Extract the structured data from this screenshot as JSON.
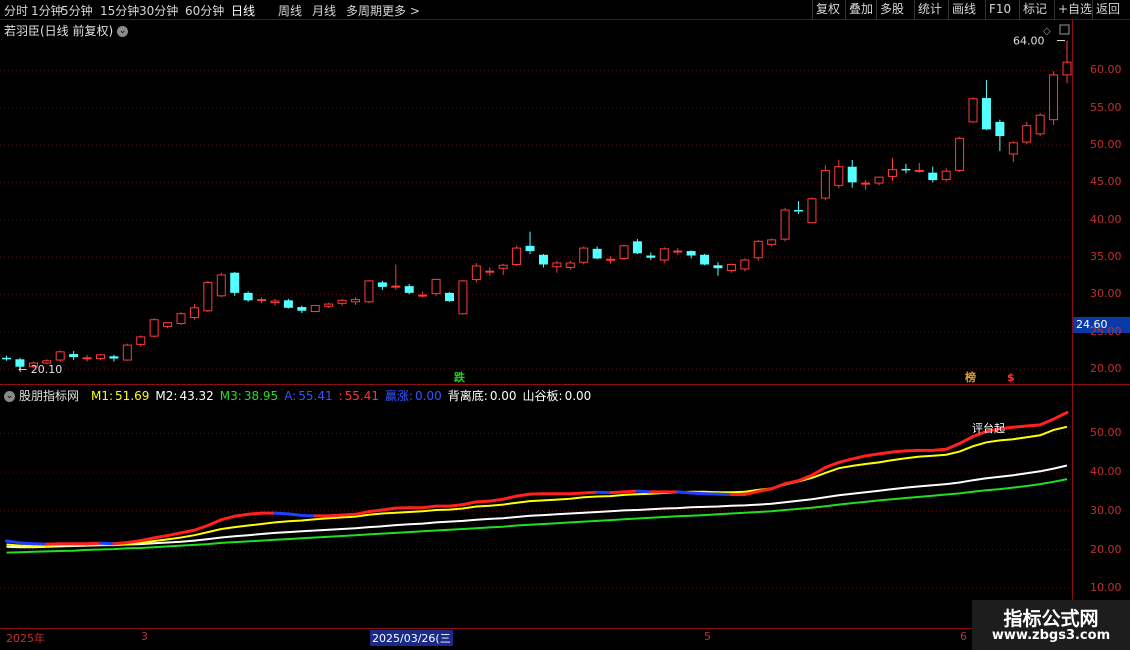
{
  "toolbar": {
    "tabs": [
      "分时",
      "1分钟",
      "5分钟",
      "15分钟",
      "30分钟",
      "60分钟",
      "日线",
      "周线",
      "月线",
      "多周期",
      "更多 >"
    ],
    "active_tab": "日线",
    "right_buttons": [
      "复权",
      "叠加",
      "多股",
      "统计",
      "画线",
      "F10",
      "标记",
      "+自选",
      "返回"
    ]
  },
  "main_chart": {
    "title": "若羽臣(日线 前复权)",
    "max_label": "64.00",
    "min_label": "20.10",
    "current_price": "24.60",
    "y_ticks": [
      "60.00",
      "55.00",
      "50.00",
      "45.00",
      "40.00",
      "35.00",
      "30.00",
      "25.00",
      "20.00"
    ],
    "markers": [
      "跌",
      "榜",
      "$"
    ]
  },
  "indicator": {
    "name": "股朋指标网",
    "items": [
      {
        "label": "M1:",
        "value": "51.69",
        "color": "#ffff00"
      },
      {
        "label": "M2:",
        "value": "43.32",
        "color": "#ffffff"
      },
      {
        "label": "M3:",
        "value": "38.95",
        "color": "#22dd22"
      },
      {
        "label": "A:",
        "value": "55.41",
        "color": "#3355ff"
      },
      {
        "label": ":",
        "value": "55.41",
        "color": "#ff3333"
      },
      {
        "label": "赢涨:",
        "value": "0.00",
        "color": "#3355ff"
      },
      {
        "label": "背离底:",
        "value": "0.00",
        "color": "#ffffff"
      },
      {
        "label": "山谷板:",
        "value": "0.00",
        "color": "#ffffff"
      }
    ],
    "annotation": "评台起",
    "y_ticks": [
      "50.00",
      "40.00",
      "30.00",
      "20.00",
      "10.00"
    ]
  },
  "date_axis": [
    "2025年",
    "3",
    "2025/03/26(三",
    "5",
    "6"
  ],
  "watermark": {
    "line1": "指标公式网",
    "line2": "www.zbgs3.com"
  },
  "colors": {
    "up": "#ff3b3b",
    "down": "#54ffff",
    "grid": "#8a1010",
    "axis_text": "#c03030"
  },
  "chart_data": {
    "type": "candlestick",
    "ylim": [
      18,
      66
    ],
    "candles": [
      [
        21.5,
        21.8,
        21.1,
        21.3
      ],
      [
        21.3,
        21.5,
        20.0,
        20.3
      ],
      [
        20.3,
        21.0,
        20.1,
        20.8
      ],
      [
        20.8,
        21.3,
        20.6,
        21.1
      ],
      [
        21.2,
        22.5,
        21.0,
        22.3
      ],
      [
        22.0,
        22.4,
        21.2,
        21.6
      ],
      [
        21.4,
        21.9,
        21.0,
        21.5
      ],
      [
        21.4,
        22.0,
        21.2,
        21.9
      ],
      [
        21.7,
        21.9,
        21.0,
        21.4
      ],
      [
        21.2,
        23.4,
        21.1,
        23.2
      ],
      [
        23.3,
        24.5,
        23.0,
        24.3
      ],
      [
        24.4,
        26.8,
        24.2,
        26.6
      ],
      [
        25.7,
        26.3,
        25.5,
        26.2
      ],
      [
        26.1,
        27.6,
        25.9,
        27.4
      ],
      [
        26.9,
        28.7,
        26.6,
        28.2
      ],
      [
        27.8,
        31.8,
        27.6,
        31.6
      ],
      [
        29.8,
        32.9,
        29.6,
        32.6
      ],
      [
        32.9,
        33.0,
        29.8,
        30.2
      ],
      [
        30.2,
        30.4,
        29.0,
        29.2
      ],
      [
        29.2,
        29.6,
        28.8,
        29.3
      ],
      [
        28.9,
        29.4,
        28.5,
        29.1
      ],
      [
        29.2,
        29.4,
        28.1,
        28.2
      ],
      [
        28.3,
        28.5,
        27.5,
        27.8
      ],
      [
        27.7,
        28.6,
        27.6,
        28.5
      ],
      [
        28.4,
        28.9,
        28.2,
        28.7
      ],
      [
        28.8,
        29.4,
        28.5,
        29.2
      ],
      [
        29.0,
        29.6,
        28.6,
        29.3
      ],
      [
        29.0,
        31.9,
        28.8,
        31.8
      ],
      [
        31.6,
        31.8,
        30.6,
        31.0
      ],
      [
        31.1,
        34.0,
        30.6,
        31.1
      ],
      [
        31.1,
        31.4,
        30.0,
        30.2
      ],
      [
        29.9,
        30.4,
        29.6,
        29.9
      ],
      [
        30.1,
        32.1,
        29.8,
        32.0
      ],
      [
        30.2,
        30.3,
        29.0,
        29.1
      ],
      [
        27.4,
        31.9,
        27.3,
        31.8
      ],
      [
        32.0,
        34.2,
        31.6,
        33.8
      ],
      [
        33.0,
        33.6,
        32.5,
        33.1
      ],
      [
        33.5,
        34.1,
        32.6,
        33.9
      ],
      [
        34.0,
        36.5,
        33.8,
        36.2
      ],
      [
        36.5,
        38.4,
        35.4,
        35.8
      ],
      [
        35.3,
        35.4,
        33.6,
        34.0
      ],
      [
        33.7,
        34.5,
        32.9,
        34.2
      ],
      [
        33.6,
        34.5,
        33.3,
        34.2
      ],
      [
        34.3,
        36.4,
        34.0,
        36.2
      ],
      [
        36.1,
        36.4,
        34.7,
        34.8
      ],
      [
        34.7,
        35.1,
        34.1,
        34.7
      ],
      [
        34.8,
        36.7,
        34.6,
        36.5
      ],
      [
        37.1,
        37.4,
        35.4,
        35.5
      ],
      [
        35.2,
        35.6,
        34.6,
        34.9
      ],
      [
        34.6,
        36.3,
        34.2,
        36.1
      ],
      [
        35.7,
        36.2,
        35.3,
        35.8
      ],
      [
        35.8,
        35.9,
        34.8,
        35.2
      ],
      [
        35.3,
        35.4,
        33.9,
        34.0
      ],
      [
        33.9,
        34.3,
        32.5,
        33.5
      ],
      [
        33.2,
        34.1,
        32.9,
        34.0
      ],
      [
        33.4,
        34.8,
        33.1,
        34.6
      ],
      [
        34.9,
        37.3,
        34.5,
        37.1
      ],
      [
        36.7,
        37.5,
        36.4,
        37.3
      ],
      [
        37.4,
        41.6,
        37.1,
        41.3
      ],
      [
        41.3,
        42.5,
        40.8,
        41.1
      ],
      [
        39.6,
        43.0,
        39.5,
        42.8
      ],
      [
        42.9,
        47.3,
        42.6,
        46.6
      ],
      [
        44.6,
        48.0,
        44.2,
        47.1
      ],
      [
        47.1,
        48.0,
        44.3,
        45.0
      ],
      [
        44.8,
        45.3,
        44.0,
        44.9
      ],
      [
        44.9,
        45.8,
        44.6,
        45.7
      ],
      [
        45.8,
        48.3,
        45.2,
        46.7
      ],
      [
        46.8,
        47.5,
        46.2,
        46.6
      ],
      [
        46.5,
        47.6,
        46.3,
        46.6
      ],
      [
        46.3,
        47.1,
        45.0,
        45.3
      ],
      [
        45.4,
        46.9,
        45.1,
        46.5
      ],
      [
        46.6,
        51.1,
        46.4,
        50.9
      ],
      [
        53.1,
        56.4,
        53.0,
        56.2
      ],
      [
        56.3,
        58.7,
        52.0,
        52.1
      ],
      [
        53.1,
        53.4,
        49.2,
        51.2
      ],
      [
        48.8,
        50.5,
        47.7,
        50.3
      ],
      [
        50.4,
        53.1,
        50.1,
        52.6
      ],
      [
        51.5,
        54.3,
        51.2,
        54.0
      ],
      [
        53.4,
        59.9,
        52.7,
        59.4
      ],
      [
        59.4,
        64.0,
        58.3,
        61.1
      ]
    ],
    "series": [
      {
        "name": "M1",
        "values": [
          21.3,
          21.0,
          20.9,
          20.9,
          21.1,
          21.1,
          21.1,
          21.2,
          21.1,
          21.4,
          21.7,
          22.2,
          22.6,
          23.1,
          23.7,
          24.5,
          25.3,
          25.8,
          26.2,
          26.6,
          27.0,
          27.3,
          27.5,
          27.8,
          28.1,
          28.3,
          28.5,
          29.0,
          29.3,
          29.5,
          29.7,
          29.9,
          30.2,
          30.3,
          30.6,
          31.1,
          31.3,
          31.6,
          32.1,
          32.5,
          32.7,
          32.9,
          33.1,
          33.5,
          33.7,
          33.8,
          34.1,
          34.3,
          34.4,
          34.6,
          34.8,
          34.9,
          34.9,
          34.8,
          34.8,
          34.9,
          35.4,
          35.8,
          36.8,
          37.6,
          38.5,
          39.8,
          41.0,
          41.6,
          42.1,
          42.5,
          43.1,
          43.6,
          44.0,
          44.2,
          44.5,
          45.3,
          46.7,
          47.7,
          48.2,
          48.5,
          49.0,
          49.5,
          50.9,
          51.7
        ]
      },
      {
        "name": "M2",
        "values": [
          20.7,
          20.6,
          20.6,
          20.7,
          20.8,
          20.9,
          21.0,
          21.1,
          21.2,
          21.3,
          21.4,
          21.6,
          21.8,
          22.0,
          22.3,
          22.7,
          23.1,
          23.4,
          23.7,
          24.0,
          24.3,
          24.5,
          24.7,
          24.9,
          25.1,
          25.3,
          25.5,
          25.8,
          26.0,
          26.3,
          26.5,
          26.7,
          27.0,
          27.2,
          27.4,
          27.7,
          27.9,
          28.1,
          28.4,
          28.7,
          28.9,
          29.1,
          29.3,
          29.5,
          29.7,
          29.9,
          30.1,
          30.2,
          30.4,
          30.6,
          30.7,
          30.9,
          31.0,
          31.1,
          31.3,
          31.4,
          31.6,
          31.8,
          32.2,
          32.6,
          33.0,
          33.5,
          34.0,
          34.4,
          34.8,
          35.2,
          35.6,
          36.0,
          36.3,
          36.6,
          36.9,
          37.3,
          37.9,
          38.4,
          38.8,
          39.2,
          39.7,
          40.2,
          40.9,
          41.7
        ]
      },
      {
        "name": "M3",
        "values": [
          19.2,
          19.3,
          19.4,
          19.5,
          19.6,
          19.7,
          19.9,
          20.0,
          20.1,
          20.3,
          20.4,
          20.6,
          20.8,
          21.0,
          21.2,
          21.4,
          21.7,
          21.9,
          22.1,
          22.3,
          22.5,
          22.7,
          22.9,
          23.1,
          23.3,
          23.5,
          23.7,
          23.9,
          24.1,
          24.3,
          24.5,
          24.7,
          24.9,
          25.1,
          25.3,
          25.5,
          25.7,
          25.9,
          26.2,
          26.4,
          26.6,
          26.8,
          27.0,
          27.2,
          27.4,
          27.6,
          27.8,
          28.0,
          28.2,
          28.4,
          28.6,
          28.7,
          28.9,
          29.1,
          29.3,
          29.5,
          29.7,
          29.9,
          30.2,
          30.5,
          30.8,
          31.2,
          31.6,
          32.0,
          32.3,
          32.7,
          33.0,
          33.3,
          33.6,
          33.9,
          34.2,
          34.5,
          34.9,
          35.3,
          35.6,
          36.0,
          36.4,
          36.9,
          37.5,
          38.2
        ]
      },
      {
        "name": "A",
        "values": [
          22.2,
          21.7,
          21.5,
          21.4,
          21.5,
          21.5,
          21.5,
          21.6,
          21.5,
          21.8,
          22.3,
          23.0,
          23.6,
          24.3,
          25.0,
          26.2,
          27.7,
          28.6,
          29.1,
          29.4,
          29.4,
          29.2,
          28.8,
          28.7,
          28.7,
          28.9,
          29.1,
          29.8,
          30.2,
          30.7,
          30.8,
          30.8,
          31.2,
          31.2,
          31.6,
          32.3,
          32.5,
          33.0,
          33.8,
          34.3,
          34.4,
          34.4,
          34.4,
          34.6,
          34.8,
          34.7,
          34.9,
          35.1,
          34.9,
          34.9,
          34.9,
          34.6,
          34.4,
          34.3,
          34.2,
          34.2,
          35.0,
          35.7,
          37.0,
          37.8,
          39.2,
          41.2,
          42.5,
          43.4,
          44.2,
          44.7,
          45.2,
          45.5,
          45.6,
          45.6,
          45.9,
          47.4,
          49.2,
          50.5,
          51.2,
          51.6,
          51.9,
          52.2,
          53.7,
          55.4
        ]
      }
    ]
  }
}
